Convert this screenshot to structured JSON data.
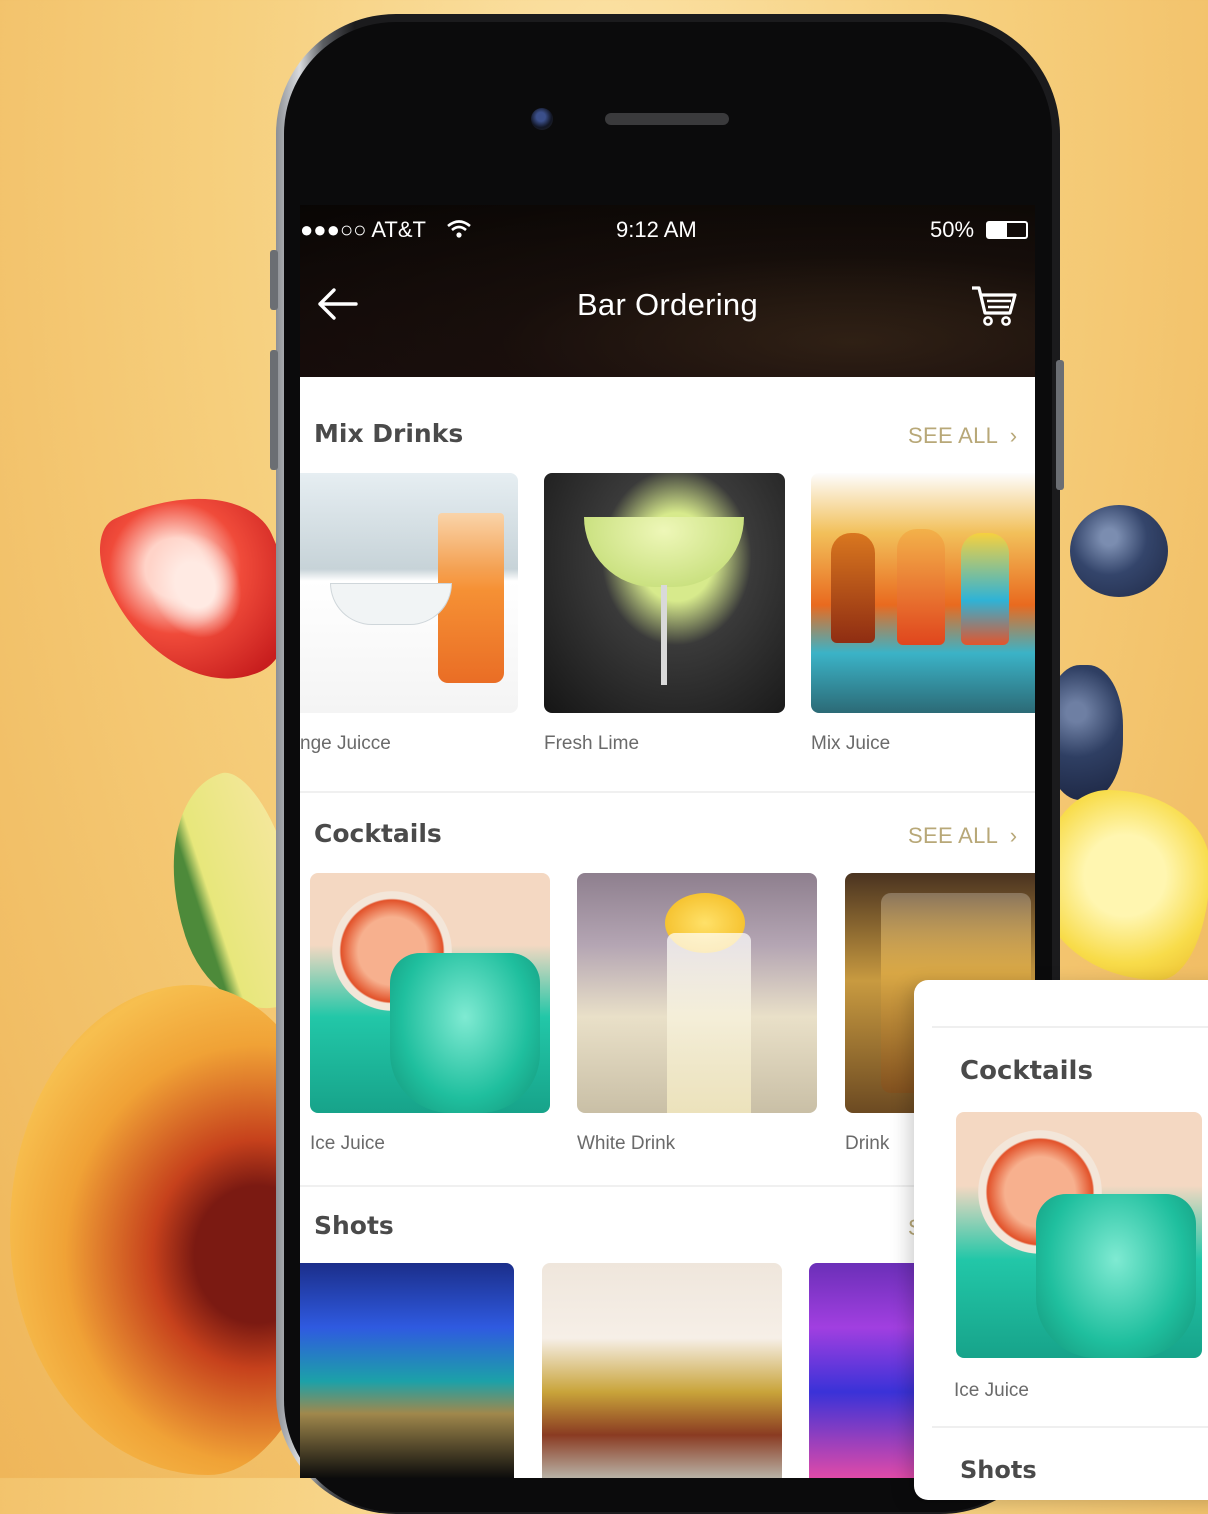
{
  "status_bar": {
    "carrier": "●●●○○ AT&T",
    "time": "9:12 AM",
    "battery": "50%"
  },
  "header": {
    "title": "Bar Ordering",
    "back_icon": "arrow-left-icon",
    "cart_icon": "cart-icon"
  },
  "sections": [
    {
      "title": "Mix Drinks",
      "see_all": "SEE ALL",
      "items": [
        {
          "label": "nge Juicce"
        },
        {
          "label": "Fresh Lime"
        },
        {
          "label": "Mix Juice"
        }
      ]
    },
    {
      "title": "Cocktails",
      "see_all": "SEE ALL",
      "items": [
        {
          "label": "Ice Juice"
        },
        {
          "label": "White Drink"
        },
        {
          "label": "Drink"
        }
      ]
    },
    {
      "title": "Shots",
      "see_all": "S"
    }
  ],
  "floating_card": {
    "section_title": "Cocktails",
    "item_label": "Ice Juice",
    "next_section": "Shots"
  },
  "colors": {
    "background": "#f6cf7d",
    "see_all": "#b8a878",
    "section_title": "#4a4a4a"
  }
}
